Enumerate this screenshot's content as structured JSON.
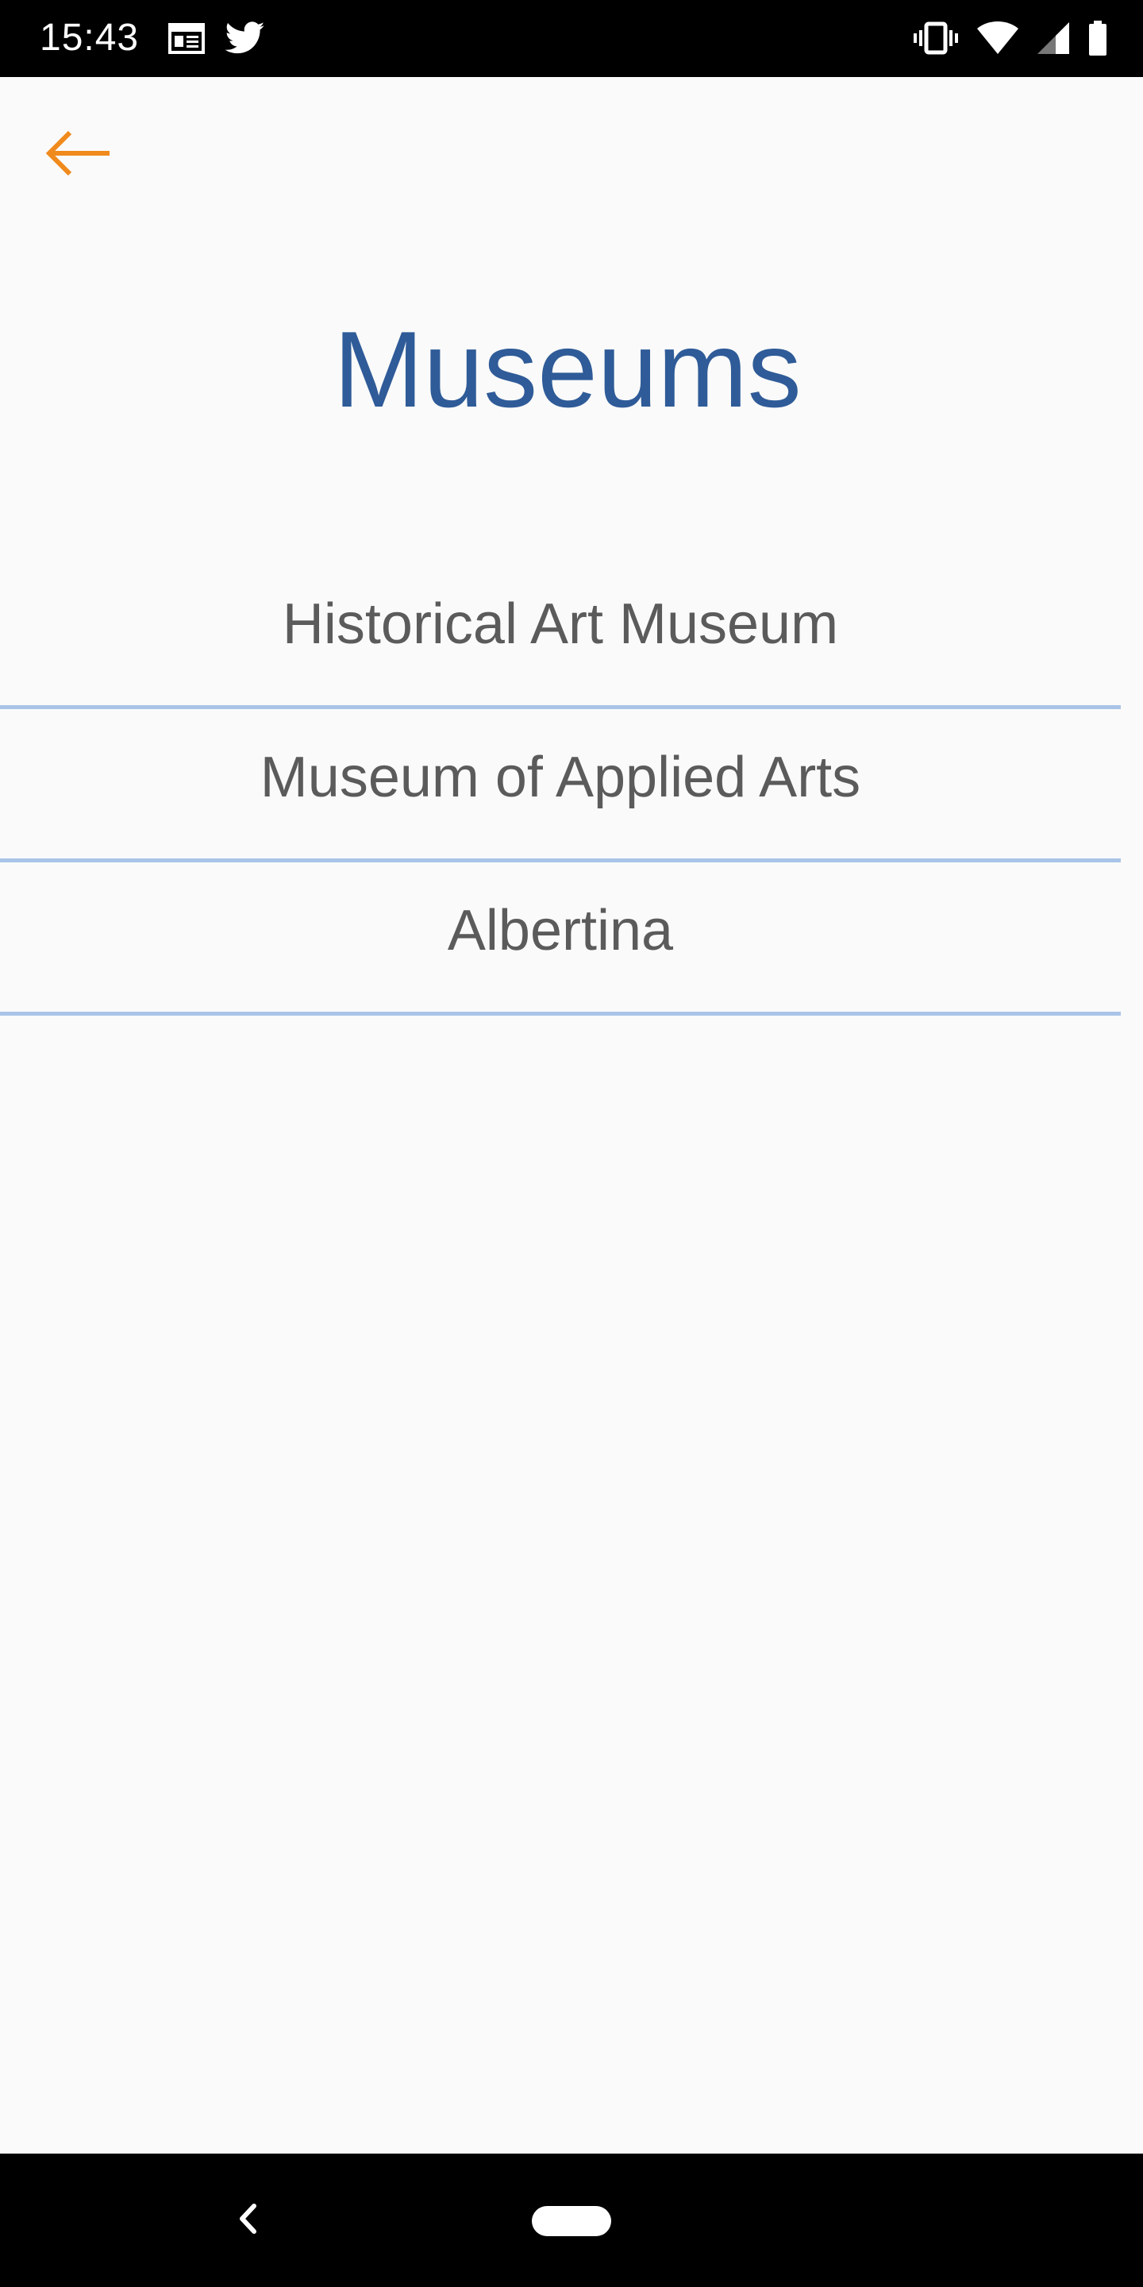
{
  "status_bar": {
    "time": "15:43",
    "left_icons": [
      "calendar-icon",
      "twitter-icon"
    ],
    "right_icons": [
      "vibrate-icon",
      "wifi-icon",
      "signal-icon",
      "battery-icon"
    ]
  },
  "header": {
    "back_icon": "arrow-left-icon",
    "accent_color": "#f08a1c"
  },
  "page": {
    "title": "Museums",
    "title_color": "#2f5b98",
    "divider_color": "#a9c4e8"
  },
  "museums": [
    {
      "label": "Historical Art Museum"
    },
    {
      "label": "Museum of Applied Arts"
    },
    {
      "label": "Albertina"
    }
  ],
  "nav_bar": {
    "back_icon": "chevron-left-icon",
    "home_icon": "home-pill-icon"
  }
}
